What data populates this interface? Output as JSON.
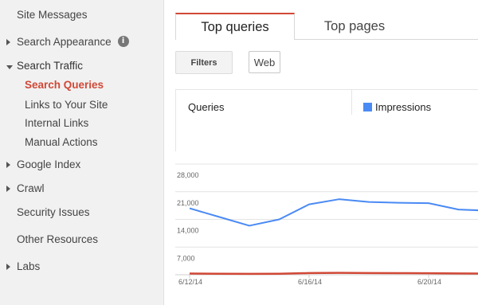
{
  "sidebar": {
    "items": [
      {
        "label": "Site Messages"
      },
      {
        "label": "Search Appearance"
      },
      {
        "label": "Search Traffic"
      },
      {
        "label": "Search Queries"
      },
      {
        "label": "Links to Your Site"
      },
      {
        "label": "Internal Links"
      },
      {
        "label": "Manual Actions"
      },
      {
        "label": "Google Index"
      },
      {
        "label": "Crawl"
      },
      {
        "label": "Security Issues"
      },
      {
        "label": "Other Resources"
      },
      {
        "label": "Labs"
      }
    ],
    "info_icon_glyph": "i"
  },
  "tabs": [
    {
      "label": "Top queries"
    },
    {
      "label": "Top pages"
    }
  ],
  "filters": {
    "button_label": "Filters",
    "chip_label": "Web"
  },
  "metrics": {
    "left_label": "Queries",
    "legend": [
      {
        "label": "Impressions",
        "color": "#4a8af4"
      }
    ]
  },
  "colors": {
    "accent": "#d14836",
    "impressions": "#4a8af4",
    "queries_line": "#d14836"
  },
  "chart_data": {
    "type": "line",
    "x": [
      "6/12/14",
      "6/13/14",
      "6/14/14",
      "6/15/14",
      "6/16/14",
      "6/17/14",
      "6/18/14",
      "6/19/14",
      "6/20/14",
      "6/21/14",
      "6/22/14"
    ],
    "x_tick_labels": [
      "6/12/14",
      "6/16/14",
      "6/20/14"
    ],
    "y_tick_labels": [
      "28,000",
      "21,000",
      "14,000",
      "7,000"
    ],
    "ylim": [
      0,
      28000
    ],
    "series": [
      {
        "name": "Impressions",
        "color": "#4a8af4",
        "values": [
          16800,
          14600,
          12400,
          14000,
          17800,
          19100,
          18400,
          18200,
          18100,
          16500,
          16200
        ]
      },
      {
        "name": "",
        "color": "#d14836",
        "values": [
          300,
          250,
          220,
          260,
          420,
          480,
          430,
          410,
          380,
          320,
          300
        ]
      }
    ],
    "grid": true
  }
}
